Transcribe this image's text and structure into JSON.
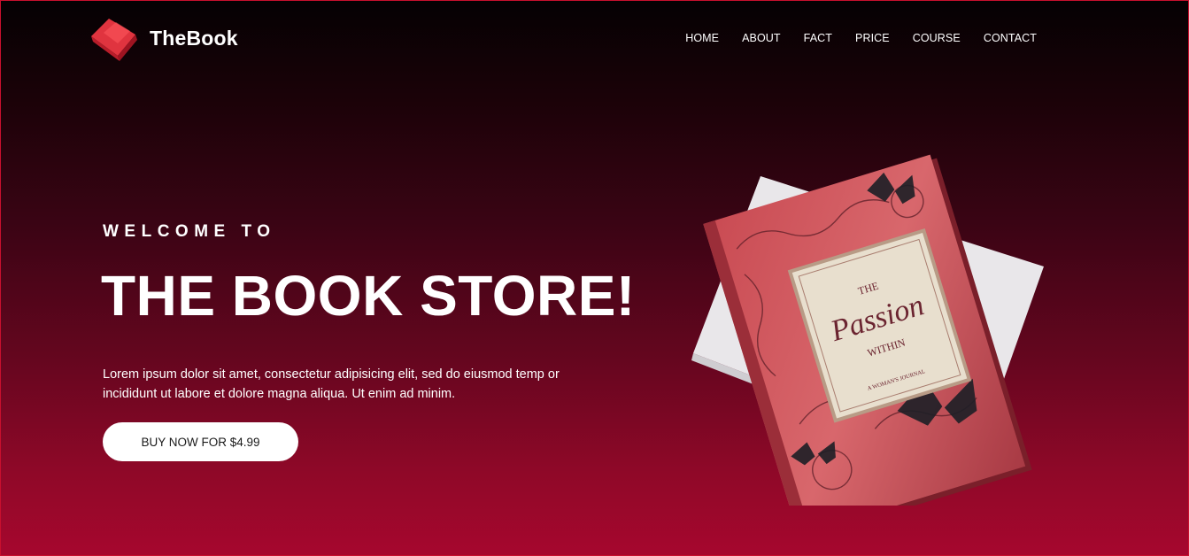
{
  "brand": {
    "name": "TheBook",
    "logo_icon": "red-book-icon"
  },
  "nav": {
    "items": [
      {
        "label": "HOME"
      },
      {
        "label": "ABOUT"
      },
      {
        "label": "FACT"
      },
      {
        "label": "PRICE"
      },
      {
        "label": "COURSE"
      },
      {
        "label": "CONTACT"
      }
    ]
  },
  "hero": {
    "welcome": "WELCOME TO",
    "title": "THE BOOK STORE!",
    "description": "Lorem ipsum dolor sit amet, consectetur adipisicing elit, sed do eiusmod temp or incididunt ut labore et dolore magna aliqua. Ut enim ad minim.",
    "cta_label": "BUY NOW FOR $4.99"
  },
  "book_cover": {
    "line1": "THE",
    "line2": "Passion",
    "line3": "WITHIN",
    "line4": "A WOMAN'S JOURNAL"
  },
  "colors": {
    "gradient_top": "#050103",
    "gradient_bottom": "#a6072e",
    "accent": "#e0343f",
    "button_bg": "#ffffff",
    "text": "#ffffff"
  }
}
